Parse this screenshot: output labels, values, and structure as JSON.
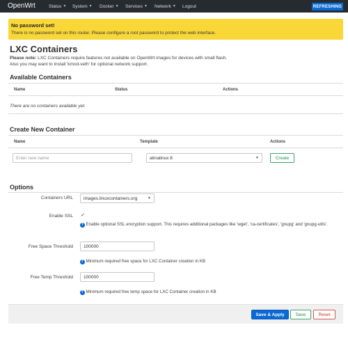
{
  "app": {
    "brand": "OpenWrt",
    "refresh_label": "REFRESHING"
  },
  "nav": [
    {
      "label": "Status",
      "has_menu": true
    },
    {
      "label": "System",
      "has_menu": true
    },
    {
      "label": "Docker",
      "has_menu": true
    },
    {
      "label": "Services",
      "has_menu": true
    },
    {
      "label": "Network",
      "has_menu": true
    },
    {
      "label": "Logout",
      "has_menu": false
    }
  ],
  "alert": {
    "title": "No password set!",
    "message": "There is no password set on this router. Please configure a root password to protect the web interface."
  },
  "page": {
    "title": "LXC Containers",
    "note_bold": "Please note:",
    "note_text": " LXC Containers require features not available on OpenWrt images for devices with small flash.",
    "note_line2": "Also you may want to install 'kmod-veth' for optional network support."
  },
  "available": {
    "title": "Available Containers",
    "columns": [
      "Name",
      "Status",
      "Actions"
    ],
    "empty_message": "There are no containers available yet."
  },
  "create": {
    "title": "Create New Container",
    "columns": [
      "Name",
      "Template",
      "Actions"
    ],
    "name_placeholder": "Enter new name",
    "template_value": "almalinux 8",
    "create_label": "Create"
  },
  "options": {
    "title": "Options",
    "url_label": "Containers URL",
    "url_value": "images.linuxcontainers.org",
    "ssl_label": "Enable SSL",
    "ssl_checked": true,
    "ssl_check_glyph": "✓",
    "ssl_help": "Enable optional SSL encryption support. This requires additional packages like 'wget', 'ca-certificates', 'gnupg' and 'gnupg-utils'.",
    "free_space_label": "Free Space Threshold",
    "free_space_value": "100000",
    "free_space_help": "Minimum required free space for LXC Container creation in KB",
    "free_temp_label": "Free Temp Threshold",
    "free_temp_value": "100000",
    "free_temp_help": "Minimum required free temp space for LXC Container creation in KB",
    "help_icon_glyph": "?"
  },
  "footer": {
    "save_apply_label": "Save & Apply",
    "save_label": "Save",
    "reset_label": "Reset"
  },
  "colors": {
    "topbar": "#262b30",
    "accent": "#0a69d4",
    "alert": "#fad738",
    "positive": "#3aa66a",
    "negative": "#d9534f"
  },
  "icons": {
    "menu_caret": "chevron-down-icon",
    "select_arrow": "chevron-down-icon",
    "help": "help-circle-icon",
    "checkbox": "checkmark-icon"
  }
}
